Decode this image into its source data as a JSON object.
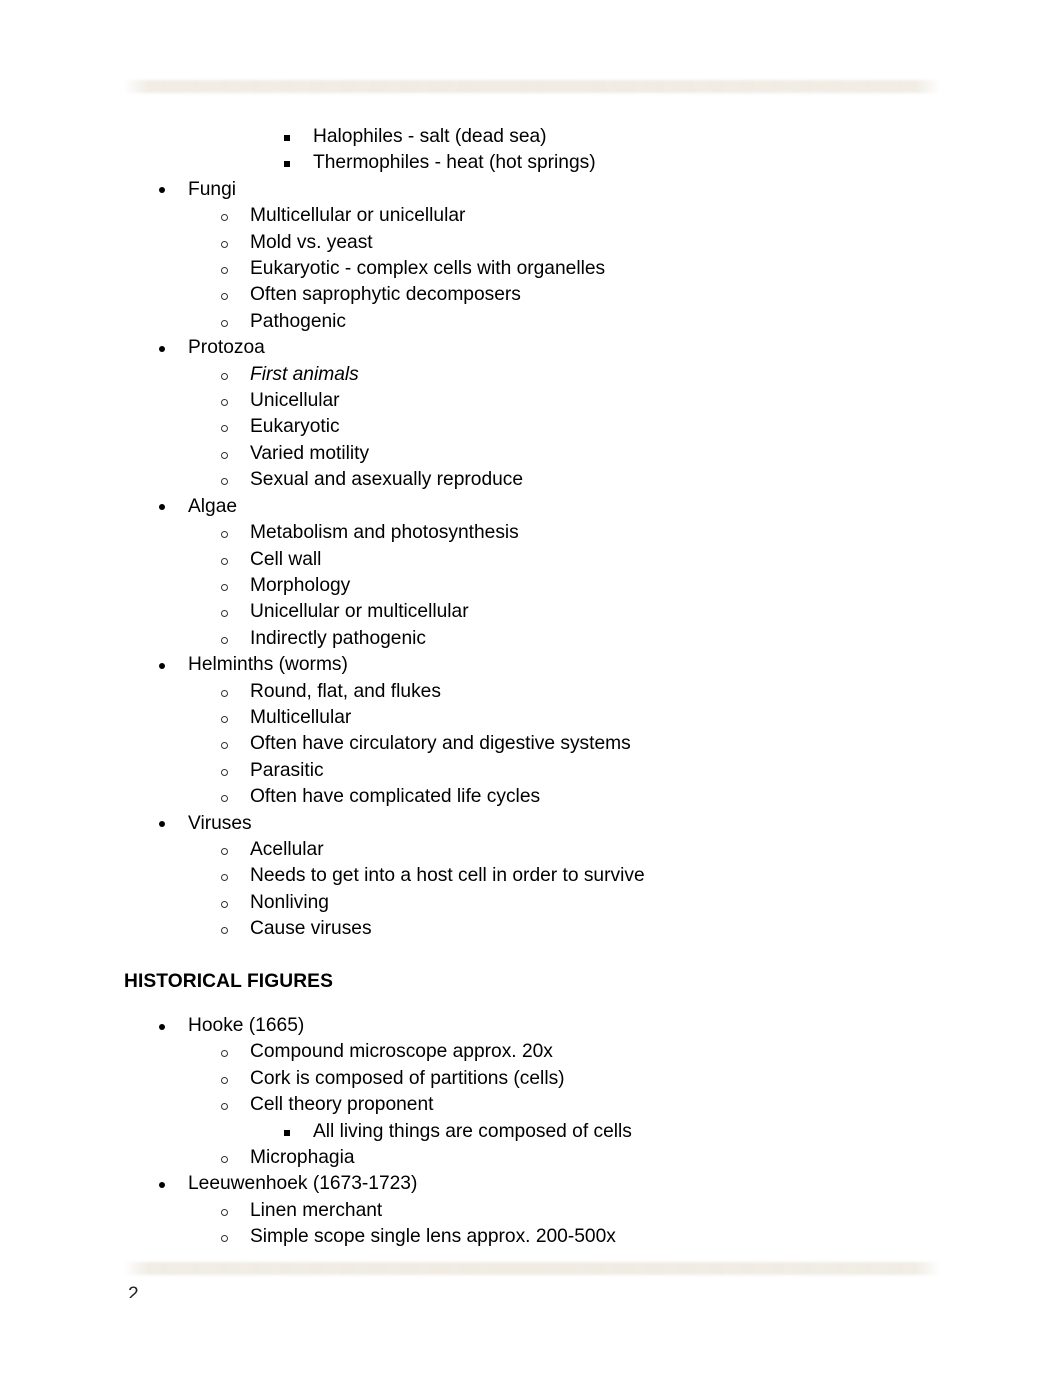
{
  "document": {
    "page_number": "2",
    "band_color": "#f0ece4",
    "text_color": "#000000"
  },
  "sections": [
    {
      "id": "organism-groups",
      "heading": null,
      "items": [
        {
          "level": 3,
          "text": "Halophiles - salt (dead sea)",
          "style": "normal"
        },
        {
          "level": 3,
          "text": "Thermophiles - heat (hot springs)",
          "style": "normal"
        },
        {
          "level": 1,
          "text": "Fungi",
          "style": "normal"
        },
        {
          "level": 2,
          "text": "Multicellular or unicellular",
          "style": "normal"
        },
        {
          "level": 2,
          "text": "Mold vs. yeast",
          "style": "normal"
        },
        {
          "level": 2,
          "text": "Eukaryotic - complex cells with organelles",
          "style": "normal"
        },
        {
          "level": 2,
          "text": "Often saprophytic decomposers",
          "style": "normal"
        },
        {
          "level": 2,
          "text": "Pathogenic",
          "style": "normal"
        },
        {
          "level": 1,
          "text": "Protozoa",
          "style": "normal"
        },
        {
          "level": 2,
          "text": "First animals",
          "style": "italic"
        },
        {
          "level": 2,
          "text": "Unicellular",
          "style": "normal"
        },
        {
          "level": 2,
          "text": "Eukaryotic",
          "style": "normal"
        },
        {
          "level": 2,
          "text": "Varied motility",
          "style": "normal"
        },
        {
          "level": 2,
          "text": "Sexual and asexually reproduce",
          "style": "normal"
        },
        {
          "level": 1,
          "text": "Algae",
          "style": "normal"
        },
        {
          "level": 2,
          "text": "Metabolism and photosynthesis",
          "style": "normal"
        },
        {
          "level": 2,
          "text": "Cell wall",
          "style": "normal"
        },
        {
          "level": 2,
          "text": "Morphology",
          "style": "normal"
        },
        {
          "level": 2,
          "text": "Unicellular or multicellular",
          "style": "normal"
        },
        {
          "level": 2,
          "text": "Indirectly pathogenic",
          "style": "normal"
        },
        {
          "level": 1,
          "text": "Helminths (worms)",
          "style": "normal"
        },
        {
          "level": 2,
          "text": "Round, flat, and flukes",
          "style": "normal"
        },
        {
          "level": 2,
          "text": "Multicellular",
          "style": "normal"
        },
        {
          "level": 2,
          "text": "Often have circulatory and digestive systems",
          "style": "normal"
        },
        {
          "level": 2,
          "text": "Parasitic",
          "style": "normal"
        },
        {
          "level": 2,
          "text": "Often have complicated life cycles",
          "style": "normal"
        },
        {
          "level": 1,
          "text": "Viruses",
          "style": "normal"
        },
        {
          "level": 2,
          "text": "Acellular",
          "style": "normal"
        },
        {
          "level": 2,
          "text": "Needs to get into a host cell in order to survive",
          "style": "normal"
        },
        {
          "level": 2,
          "text": "Nonliving",
          "style": "normal"
        },
        {
          "level": 2,
          "text": "Cause viruses",
          "style": "normal"
        }
      ]
    },
    {
      "id": "historical-figures",
      "heading": "HISTORICAL FIGURES",
      "items": [
        {
          "level": 1,
          "text": "Hooke (1665)",
          "style": "normal"
        },
        {
          "level": 2,
          "text": "Compound microscope approx. 20x",
          "style": "normal"
        },
        {
          "level": 2,
          "text": "Cork is composed of partitions (cells)",
          "style": "normal"
        },
        {
          "level": 2,
          "text": "Cell theory proponent",
          "style": "normal"
        },
        {
          "level": 3,
          "text": "All living things are composed of cells",
          "style": "normal"
        },
        {
          "level": 2,
          "text": "Microphagia",
          "style": "normal"
        },
        {
          "level": 1,
          "text": "Leeuwenhoek (1673-1723)",
          "style": "normal"
        },
        {
          "level": 2,
          "text": "Linen merchant",
          "style": "normal"
        },
        {
          "level": 2,
          "text": "Simple scope single lens approx. 200-500x",
          "style": "normal"
        }
      ]
    }
  ]
}
